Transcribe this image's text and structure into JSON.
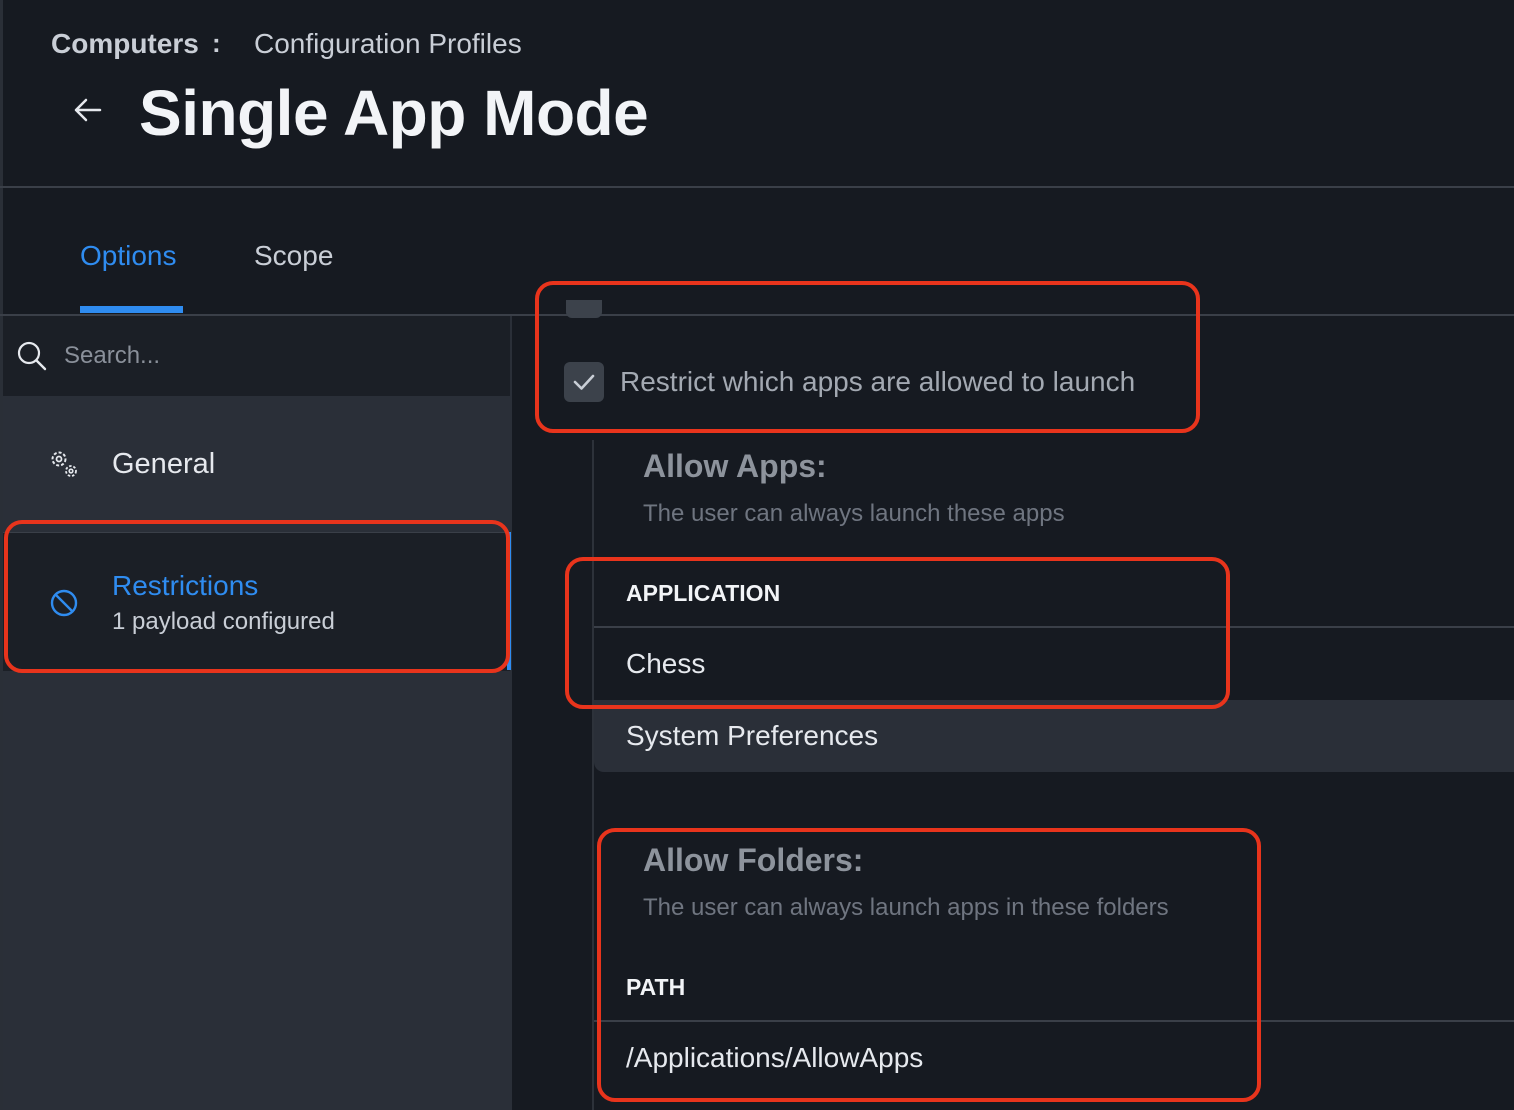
{
  "breadcrumb": {
    "root": "Computers",
    "separator": ":",
    "current": "Configuration Profiles"
  },
  "page": {
    "title": "Single App Mode"
  },
  "tabs": [
    {
      "label": "Options",
      "active": true
    },
    {
      "label": "Scope",
      "active": false
    }
  ],
  "sidebar": {
    "search": {
      "placeholder": "Search...",
      "value": ""
    },
    "items": [
      {
        "label": "General",
        "icon": "gear-icon"
      },
      {
        "label": "Restrictions",
        "subtitle": "1 payload configured",
        "icon": "ban-icon",
        "selected": true
      }
    ]
  },
  "main": {
    "restrict_checkbox": {
      "label": "Restrict which apps are allowed to launch",
      "checked": true
    },
    "allow_apps": {
      "title": "Allow Apps:",
      "description": "The user can always launch these apps",
      "column_header": "APPLICATION",
      "rows": [
        "Chess",
        "System Preferences"
      ]
    },
    "allow_folders": {
      "title": "Allow Folders:",
      "description": "The user can always launch apps in these folders",
      "column_header": "PATH",
      "rows": [
        "/Applications/AllowApps"
      ]
    }
  },
  "colors": {
    "accent": "#2f8cf0",
    "background": "#161a21",
    "annotation": "#e8341c"
  }
}
